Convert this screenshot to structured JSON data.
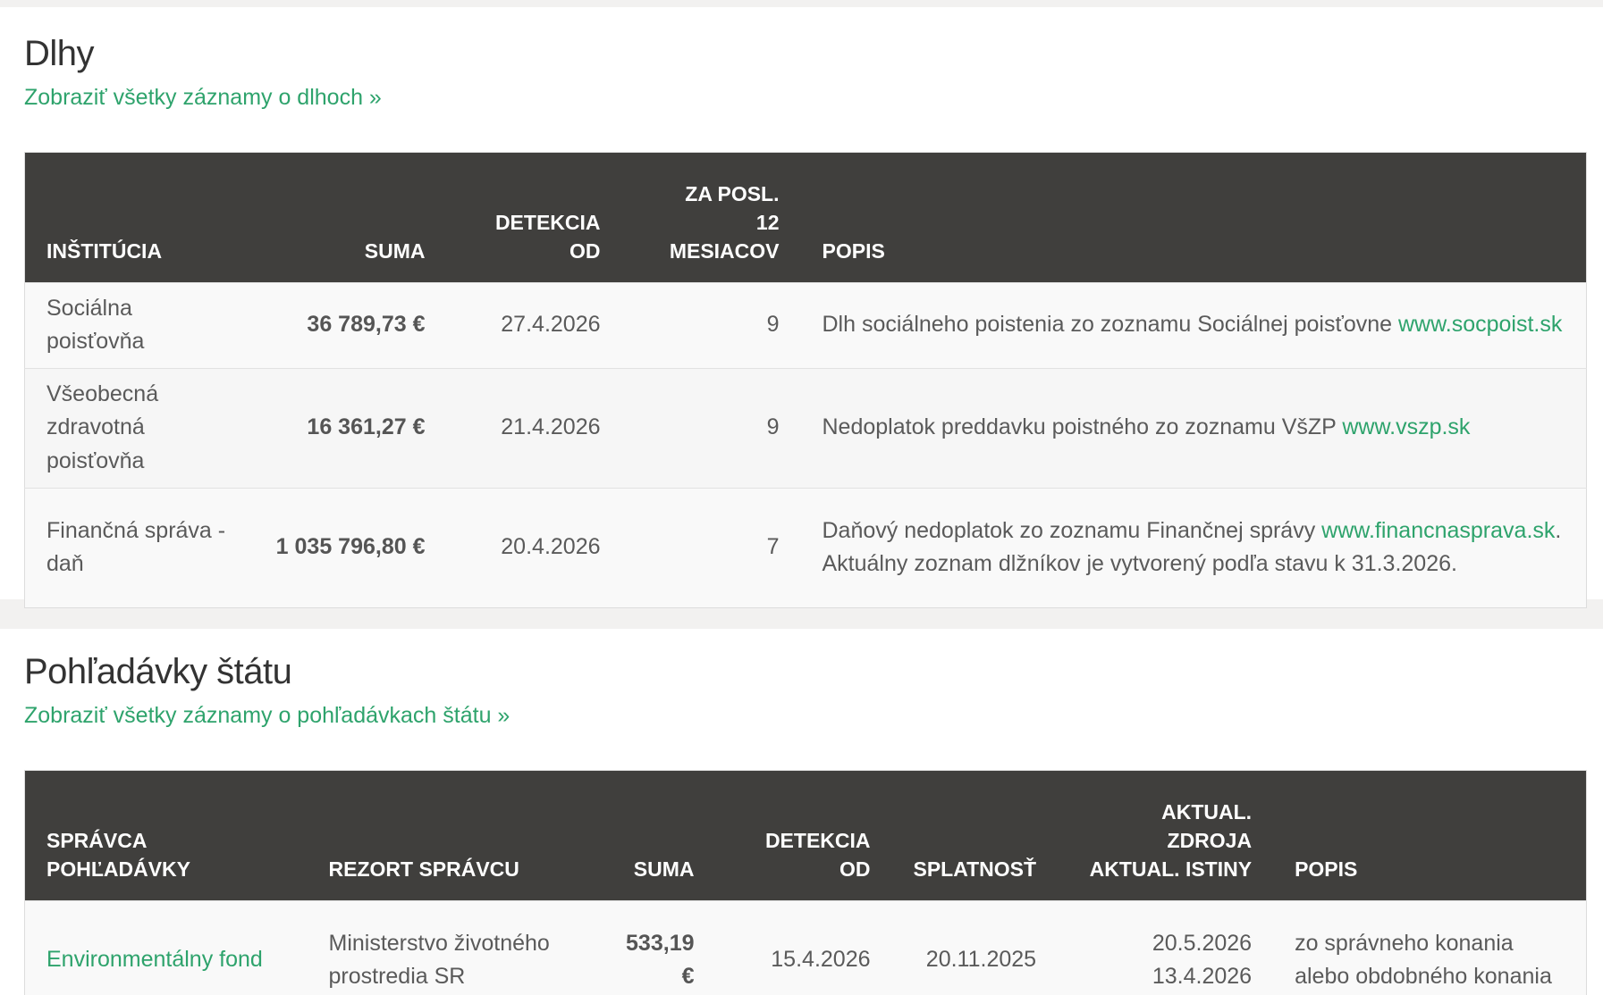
{
  "debts": {
    "title": "Dlhy",
    "link_label": "Zobraziť všetky záznamy o dlhoch »",
    "columns": {
      "institution": "INŠTITÚCIA",
      "amount": "SUMA",
      "detected_from": "DETEKCIA OD",
      "last12_line1": "ZA POSL.",
      "last12_line2": "12 MESIACOV",
      "description": "POPIS"
    },
    "rows": [
      {
        "institution": "Sociálna poisťovňa",
        "amount": "36 789,73 €",
        "detected_from": "27.4.2026",
        "last12": "9",
        "description_text": "Dlh sociálneho poistenia zo zoznamu Sociálnej poisťovne ",
        "description_link": "www.socpoist.sk",
        "description_tail": ""
      },
      {
        "institution": "Všeobecná zdravotná poisťovňa",
        "amount": "16 361,27 €",
        "detected_from": "21.4.2026",
        "last12": "9",
        "description_text": "Nedoplatok preddavku poistného zo zoznamu VšZP ",
        "description_link": "www.vszp.sk",
        "description_tail": ""
      },
      {
        "institution": "Finančná správa - daň",
        "amount": "1 035 796,80 €",
        "detected_from": "20.4.2026",
        "last12": "7",
        "description_text": "Daňový nedoplatok zo zoznamu Finančnej správy ",
        "description_link": "www.financnasprava.sk",
        "description_tail": ". Aktuálny zoznam dlžníkov je vytvorený podľa stavu k 31.3.2026."
      }
    ]
  },
  "claims": {
    "title": "Pohľadávky štátu",
    "link_label": "Zobraziť všetky záznamy o pohľadávkach štátu »",
    "columns": {
      "administrator": "SPRÁVCA POHĽADÁVKY",
      "department": "REZORT SPRÁVCU",
      "amount": "SUMA",
      "detected_from": "DETEKCIA OD",
      "due": "SPLATNOSŤ",
      "update_line1": "AKTUAL. ZDROJA",
      "update_line2": "AKTUAL. ISTINY",
      "description": "POPIS"
    },
    "rows": [
      {
        "administrator": "Environmentálny fond",
        "department": "Ministerstvo životného prostredia SR",
        "amount": "533,19 €",
        "detected_from": "15.4.2026",
        "due": "20.11.2025",
        "source_update": "20.5.2026",
        "principal_update": "13.4.2026",
        "description": "zo správneho konania alebo obdobného konania"
      }
    ]
  },
  "colors": {
    "accent": "#2ea36c",
    "header_bg": "#403f3d",
    "page_bg": "#f2f1f0"
  }
}
